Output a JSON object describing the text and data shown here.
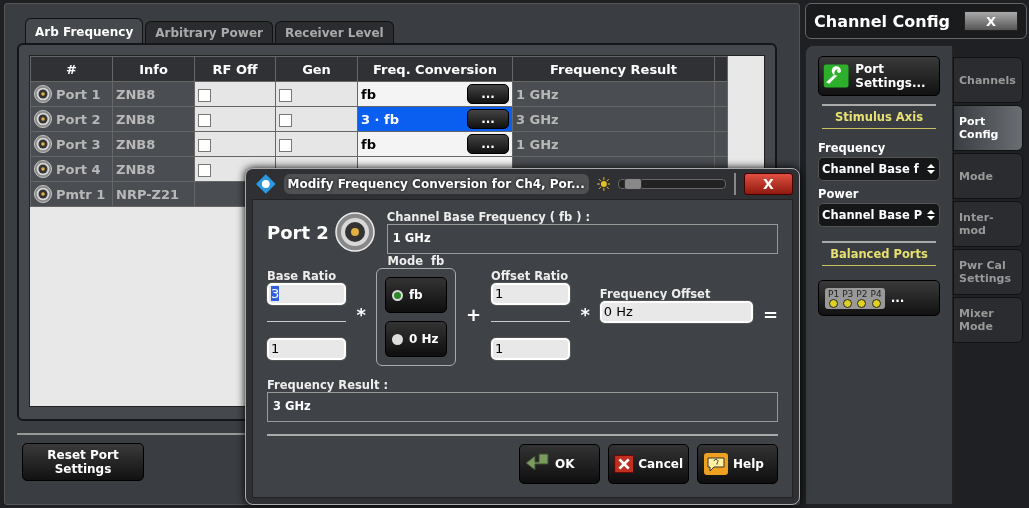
{
  "tabs": [
    {
      "label": "Arb Frequency",
      "selected": true
    },
    {
      "label": "Arbitrary Power",
      "selected": false
    },
    {
      "label": "Receiver Level",
      "selected": false
    }
  ],
  "table": {
    "columns": [
      "#",
      "Info",
      "RF Off",
      "Gen",
      "Freq. Conversion",
      "Frequency Result"
    ],
    "rows": [
      {
        "kind": "port",
        "name": "Port 1",
        "info": "ZNB8",
        "rf_off": false,
        "gen": false,
        "freq_conversion": "fb",
        "action_button": "...",
        "selected": false,
        "frequency_result": "1 GHz"
      },
      {
        "kind": "port",
        "name": "Port 2",
        "info": "ZNB8",
        "rf_off": false,
        "gen": false,
        "freq_conversion": "3 · fb",
        "action_button": "...",
        "selected": true,
        "frequency_result": "3 GHz"
      },
      {
        "kind": "port",
        "name": "Port 3",
        "info": "ZNB8",
        "rf_off": false,
        "gen": false,
        "freq_conversion": "fb",
        "action_button": "...",
        "selected": false,
        "frequency_result": "1 GHz"
      },
      {
        "kind": "port",
        "name": "Port 4",
        "info": "ZNB8",
        "rf_off": false
      },
      {
        "kind": "power_meter",
        "name": "Pmtr 1",
        "info": "NRP-Z21"
      }
    ]
  },
  "reset_button": "Reset Port Settings",
  "side_panel": {
    "title": "Channel Config",
    "close_label": "X",
    "port_settings_button": "Port Settings...",
    "stimulus_heading": "Stimulus Axis",
    "frequency_label": "Frequency",
    "frequency_value": "Channel Base f",
    "power_label": "Power",
    "power_value": "Channel Base P",
    "balanced_heading": "Balanced Ports",
    "balanced_ports": [
      "P1",
      "P3",
      "P2",
      "P4"
    ],
    "balanced_button": "...",
    "tabs": [
      {
        "label": "Channels",
        "selected": false
      },
      {
        "label": "Port Config",
        "selected": true
      },
      {
        "label": "Mode",
        "selected": false
      },
      {
        "label": "Inter- mod",
        "selected": false
      },
      {
        "label": "Pwr Cal Settings",
        "selected": false
      },
      {
        "label": "Mixer Mode",
        "selected": false
      }
    ]
  },
  "dialog": {
    "title": "Modify Frequency Conversion for Ch4, Por...",
    "transparency": {
      "level": 0.05
    },
    "close_label": "X",
    "port_label": "Port 2",
    "base_freq_label": "Channel Base Frequency ( fb ) :",
    "base_freq_value": "1 GHz",
    "base_ratio": {
      "label": "Base Ratio",
      "numerator": "3",
      "denominator": "1",
      "numerator_highlighted": true
    },
    "mode_label": "Mode  fb",
    "mode_options": [
      {
        "label": "fb",
        "selected": true
      },
      {
        "label": "0 Hz",
        "selected": false
      }
    ],
    "offset_ratio": {
      "label": "Offset Ratio",
      "numerator": "1",
      "denominator": "1",
      "numerator_highlighted": false
    },
    "frequency_offset_label": "Frequency Offset",
    "frequency_offset_value": "0 Hz",
    "operators": [
      "*",
      "+",
      "*",
      "="
    ],
    "result_label": "Frequency Result :",
    "result_value": "3 GHz",
    "buttons": [
      {
        "kind": "ok",
        "label": "OK"
      },
      {
        "kind": "cancel",
        "label": "Cancel"
      },
      {
        "kind": "help",
        "label": "Help"
      }
    ]
  }
}
